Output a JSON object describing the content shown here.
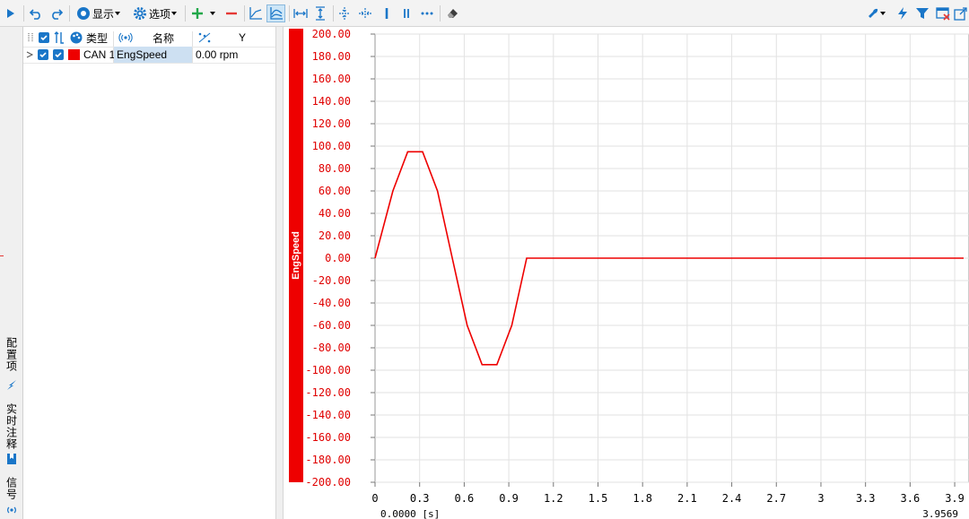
{
  "toolbar": {
    "display_label": "显示",
    "options_label": "选项",
    "icons": [
      "play-icon",
      "undo-icon",
      "redo-icon",
      "display-icon",
      "gear-icon",
      "add-icon",
      "remove-icon",
      "line-chart-icon",
      "curve-chart-icon",
      "fit-horizontal-icon",
      "fit-vertical-icon",
      "zoom-in-icon",
      "zoom-out-icon",
      "cursor-single-icon",
      "cursor-double-icon",
      "more-icon",
      "eraser-icon",
      "wrench-icon",
      "lightning-icon",
      "filter-icon",
      "window-close-icon",
      "export-icon"
    ]
  },
  "side_tabs": {
    "config": "配置项",
    "annotation": "实时注释",
    "signal": "信号"
  },
  "table": {
    "headers": {
      "type": "类型",
      "name": "名称",
      "y": "Y"
    },
    "rows": [
      {
        "channel": "CAN 1",
        "name": "EngSpeed",
        "y": "0.00 rpm",
        "color": "#ee0000"
      }
    ]
  },
  "chart_data": {
    "type": "line",
    "ylabel": "EngSpeed",
    "ylim": [
      -200,
      200
    ],
    "y_ticks": [
      "200.00",
      "180.00",
      "160.00",
      "140.00",
      "120.00",
      "100.00",
      "80.00",
      "60.00",
      "40.00",
      "20.00",
      "0.00",
      "-20.00",
      "-40.00",
      "-60.00",
      "-80.00",
      "-100.00",
      "-120.00",
      "-140.00",
      "-160.00",
      "-180.00",
      "-200.00"
    ],
    "x_ticks": [
      "0",
      "0.3",
      "0.6",
      "0.9",
      "1.2",
      "1.5",
      "1.8",
      "2.1",
      "2.4",
      "2.7",
      "3",
      "3.3",
      "3.6",
      "3.9"
    ],
    "xlim_start": "0.0000 [s]",
    "xlim_end": "3.9569",
    "series": [
      {
        "name": "EngSpeed",
        "color": "#ee0000",
        "x": [
          0,
          0.12,
          0.22,
          0.32,
          0.42,
          0.52,
          0.62,
          0.72,
          0.82,
          0.92,
          1.02,
          3.96
        ],
        "y": [
          0,
          60,
          95,
          95,
          60,
          0,
          -60,
          -95,
          -95,
          -60,
          0,
          0
        ]
      }
    ],
    "grid": true
  }
}
